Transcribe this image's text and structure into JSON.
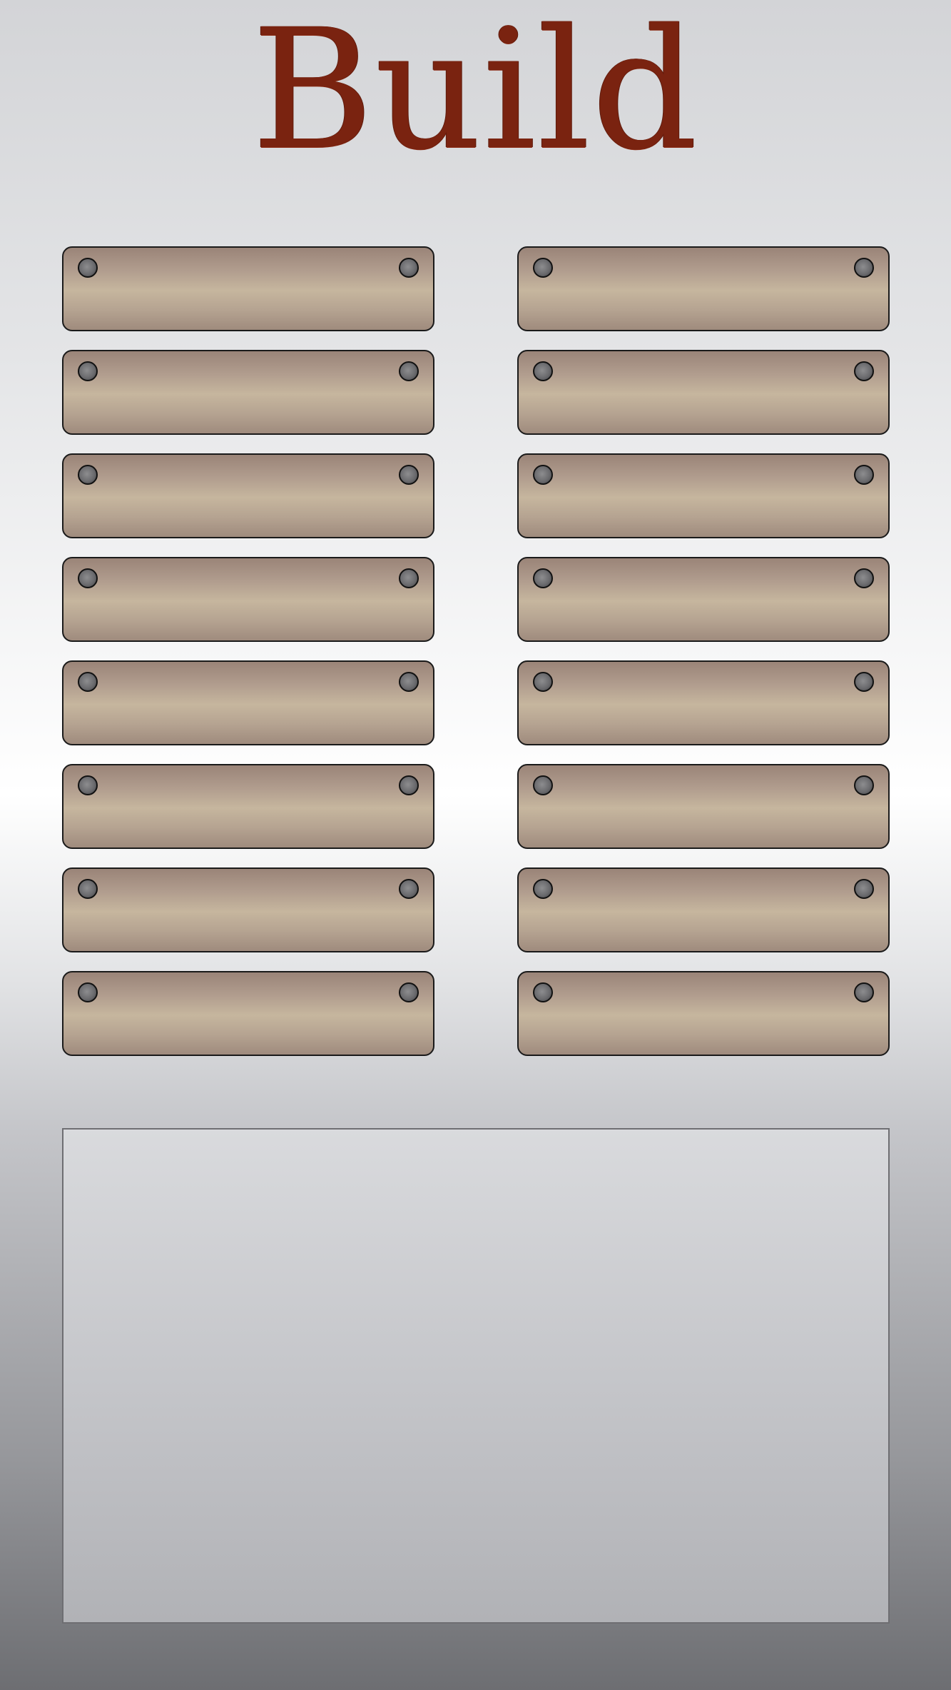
{
  "screen": {
    "title": "Build"
  },
  "build_slots": [
    {
      "label": ""
    },
    {
      "label": ""
    },
    {
      "label": ""
    },
    {
      "label": ""
    },
    {
      "label": ""
    },
    {
      "label": ""
    },
    {
      "label": ""
    },
    {
      "label": ""
    },
    {
      "label": ""
    },
    {
      "label": ""
    },
    {
      "label": ""
    },
    {
      "label": ""
    },
    {
      "label": ""
    },
    {
      "label": ""
    },
    {
      "label": ""
    },
    {
      "label": ""
    }
  ],
  "info_panel": {
    "text": ""
  },
  "colors": {
    "title": "#7a2310",
    "plank_light": "#c6b69e",
    "plank_dark": "#9a8478",
    "bolt": "#6b6b6e"
  },
  "icons": {
    "plank_fastener": "bolt-icon"
  }
}
